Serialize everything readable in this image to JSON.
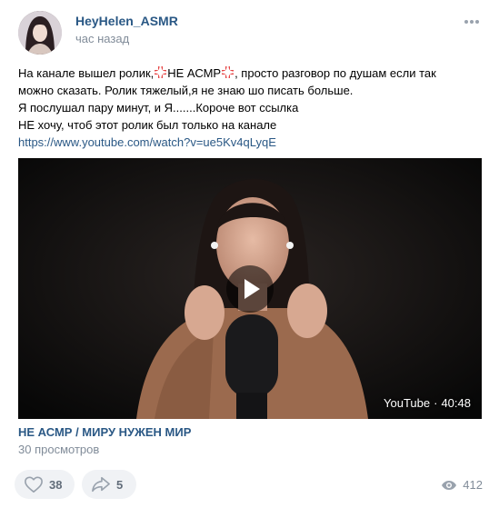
{
  "post": {
    "author": "HeyHelen_ASMR",
    "time": "час назад",
    "text": {
      "line1_a": "На канале вышел ролик,",
      "line1_b": "НЕ АСМР",
      "line1_c": ", просто разговор по душам если так",
      "line2": "можно сказать. Ролик тяжелый,я не знаю шо писать больше.",
      "line3": "Я послушал пару минут, и Я.......Короче вот ссылка",
      "line4": "НЕ хочу, чтоб этот ролик был только на канале",
      "link": "https://www.youtube.com/watch?v=ue5Kv4qLyqE"
    },
    "emoji_icon": "anger-symbol-icon",
    "video": {
      "source_label": "YouTube",
      "separator": "·",
      "duration": "40:48",
      "title": "НЕ АСМР / МИРУ НУЖЕН МИР",
      "views": "30 просмотров"
    },
    "actions": {
      "likes": "38",
      "shares": "5",
      "views": "412"
    },
    "colors": {
      "link": "#2a5885",
      "meta": "#818c99",
      "button_bg": "#f0f2f5",
      "emoji": "#e64646"
    }
  }
}
